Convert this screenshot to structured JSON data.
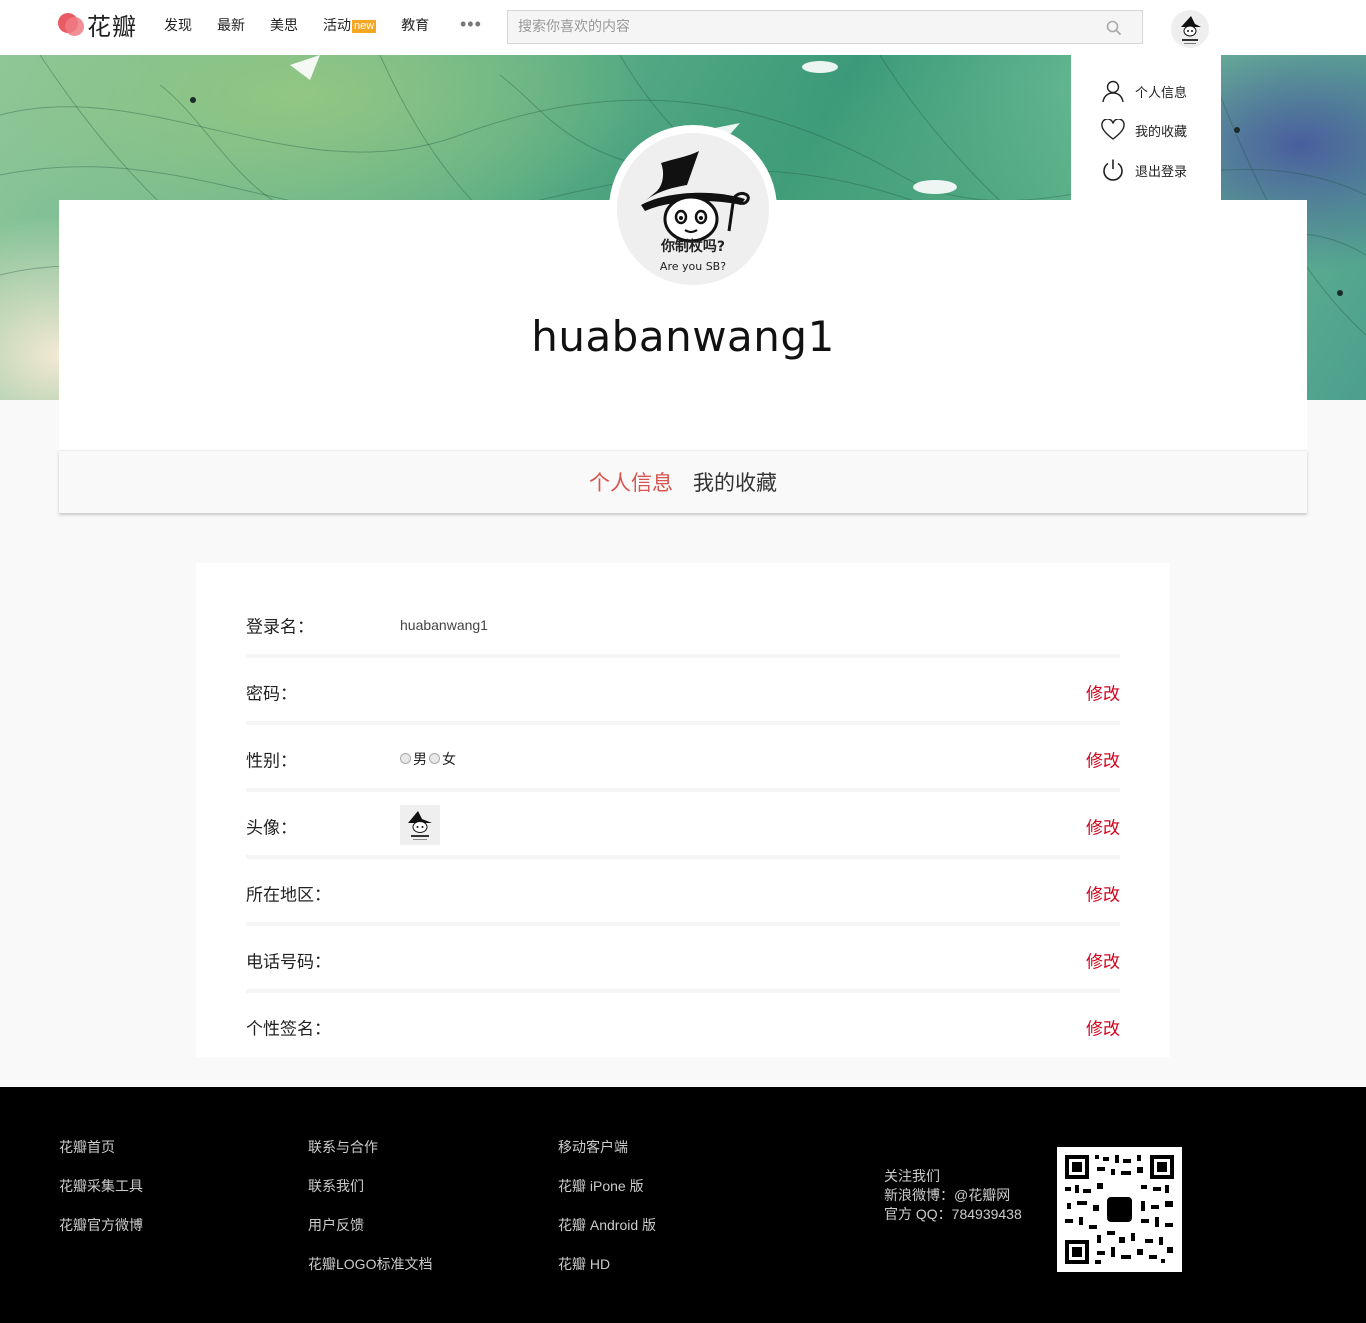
{
  "nav": {
    "brand": "花瓣",
    "links": [
      "发现",
      "最新",
      "美思",
      "活动",
      "教育"
    ],
    "new_badge": "new",
    "more": "•••",
    "search_placeholder": "搜索你喜欢的内容"
  },
  "user_menu": {
    "items": [
      "个人信息",
      "我的收藏",
      "退出登录"
    ]
  },
  "profile": {
    "username": "huabanwang1",
    "avatar_caption_cn": "你制杖吗?",
    "avatar_caption_en": "Are you SB?"
  },
  "tabs": {
    "active": "个人信息",
    "inactive": "我的收藏"
  },
  "info": {
    "edit_label": "修改",
    "rows": [
      {
        "label": "登录名：",
        "value": "huabanwang1"
      },
      {
        "label": "密码："
      },
      {
        "label": "性别：",
        "options": [
          "男",
          "女"
        ]
      },
      {
        "label": "头像："
      },
      {
        "label": "所在地区："
      },
      {
        "label": "电话号码："
      },
      {
        "label": "个性签名："
      }
    ]
  },
  "footer": {
    "col1": [
      "花瓣首页",
      "花瓣采集工具",
      "花瓣官方微博"
    ],
    "col2": [
      "联系与合作",
      "联系我们",
      "用户反馈",
      "花瓣LOGO标准文档"
    ],
    "col3": [
      "移动客户端",
      "花瓣 iPone 版",
      "花瓣 Android 版",
      "花瓣 HD"
    ],
    "follow_title": "关注我们",
    "weibo": "新浪微博：@花瓣网",
    "qq": "官方 QQ：784939438"
  },
  "colors": {
    "accent_red": "#d0021b",
    "tab_active": "#d9534f",
    "badge": "#f5a623",
    "footer_bg": "#000000"
  }
}
